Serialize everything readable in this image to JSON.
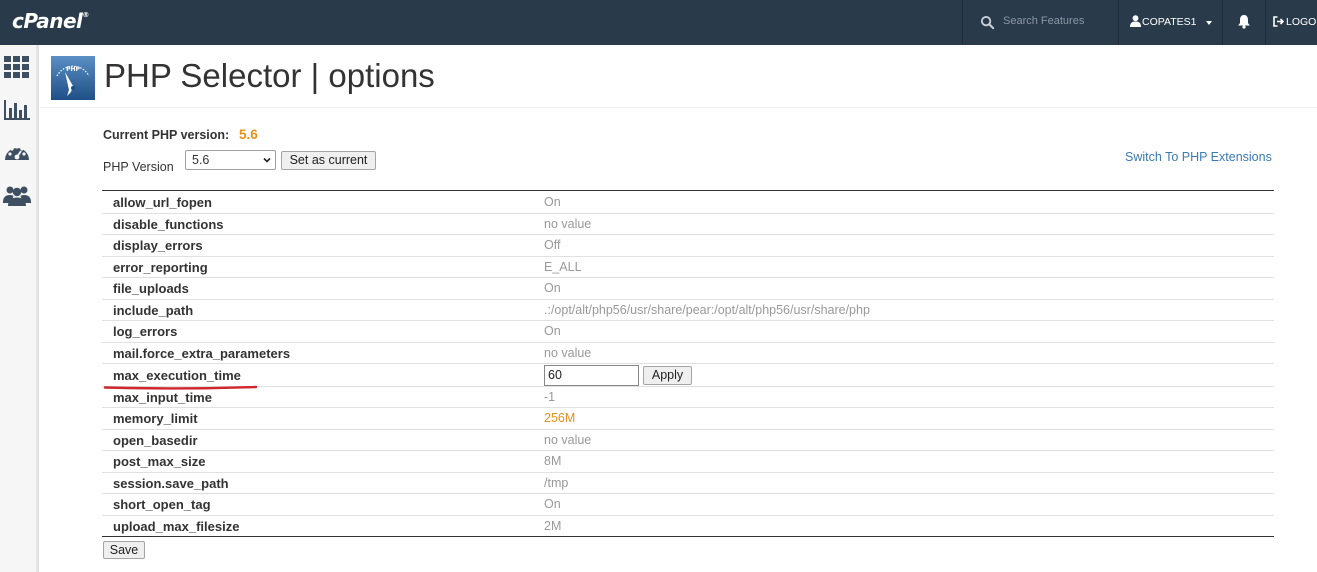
{
  "topbar": {
    "logo": "cPanel",
    "logo_mark": "®",
    "search_placeholder": "Search Features",
    "username": "COPATES1",
    "logout_label": "LOGOUT"
  },
  "sidebar": {
    "items": [
      {
        "icon": "grid-icon"
      },
      {
        "icon": "bar-chart-icon"
      },
      {
        "icon": "dashboard-gauge-icon"
      },
      {
        "icon": "users-icon"
      }
    ]
  },
  "header": {
    "title": "PHP Selector | options",
    "logo_text": "PHP"
  },
  "current": {
    "label": "Current PHP version:",
    "value": "5.6"
  },
  "version_picker": {
    "label": "PHP Version",
    "selected": "5.6",
    "set_button": "Set as current"
  },
  "switch_link": "Switch To PHP Extensions",
  "options": [
    {
      "name": "allow_url_fopen",
      "value": "On"
    },
    {
      "name": "disable_functions",
      "value": "no value"
    },
    {
      "name": "display_errors",
      "value": "Off"
    },
    {
      "name": "error_reporting",
      "value": "E_ALL"
    },
    {
      "name": "file_uploads",
      "value": "On"
    },
    {
      "name": "include_path",
      "value": ".:/opt/alt/php56/usr/share/pear:/opt/alt/php56/usr/share/php"
    },
    {
      "name": "log_errors",
      "value": "On"
    },
    {
      "name": "mail.force_extra_parameters",
      "value": "no value"
    },
    {
      "name": "max_execution_time",
      "value": "60",
      "editing": true,
      "apply_label": "Apply"
    },
    {
      "name": "max_input_time",
      "value": "-1"
    },
    {
      "name": "memory_limit",
      "value": "256M",
      "highlight": true
    },
    {
      "name": "open_basedir",
      "value": "no value"
    },
    {
      "name": "post_max_size",
      "value": "8M"
    },
    {
      "name": "session.save_path",
      "value": "/tmp"
    },
    {
      "name": "short_open_tag",
      "value": "On"
    },
    {
      "name": "upload_max_filesize",
      "value": "2M"
    }
  ],
  "save_label": "Save",
  "colors": {
    "topbar": "#293a4a",
    "accent_orange": "#e8901a",
    "link_blue": "#3b7ab4",
    "annotation_red": "#d0262c"
  }
}
